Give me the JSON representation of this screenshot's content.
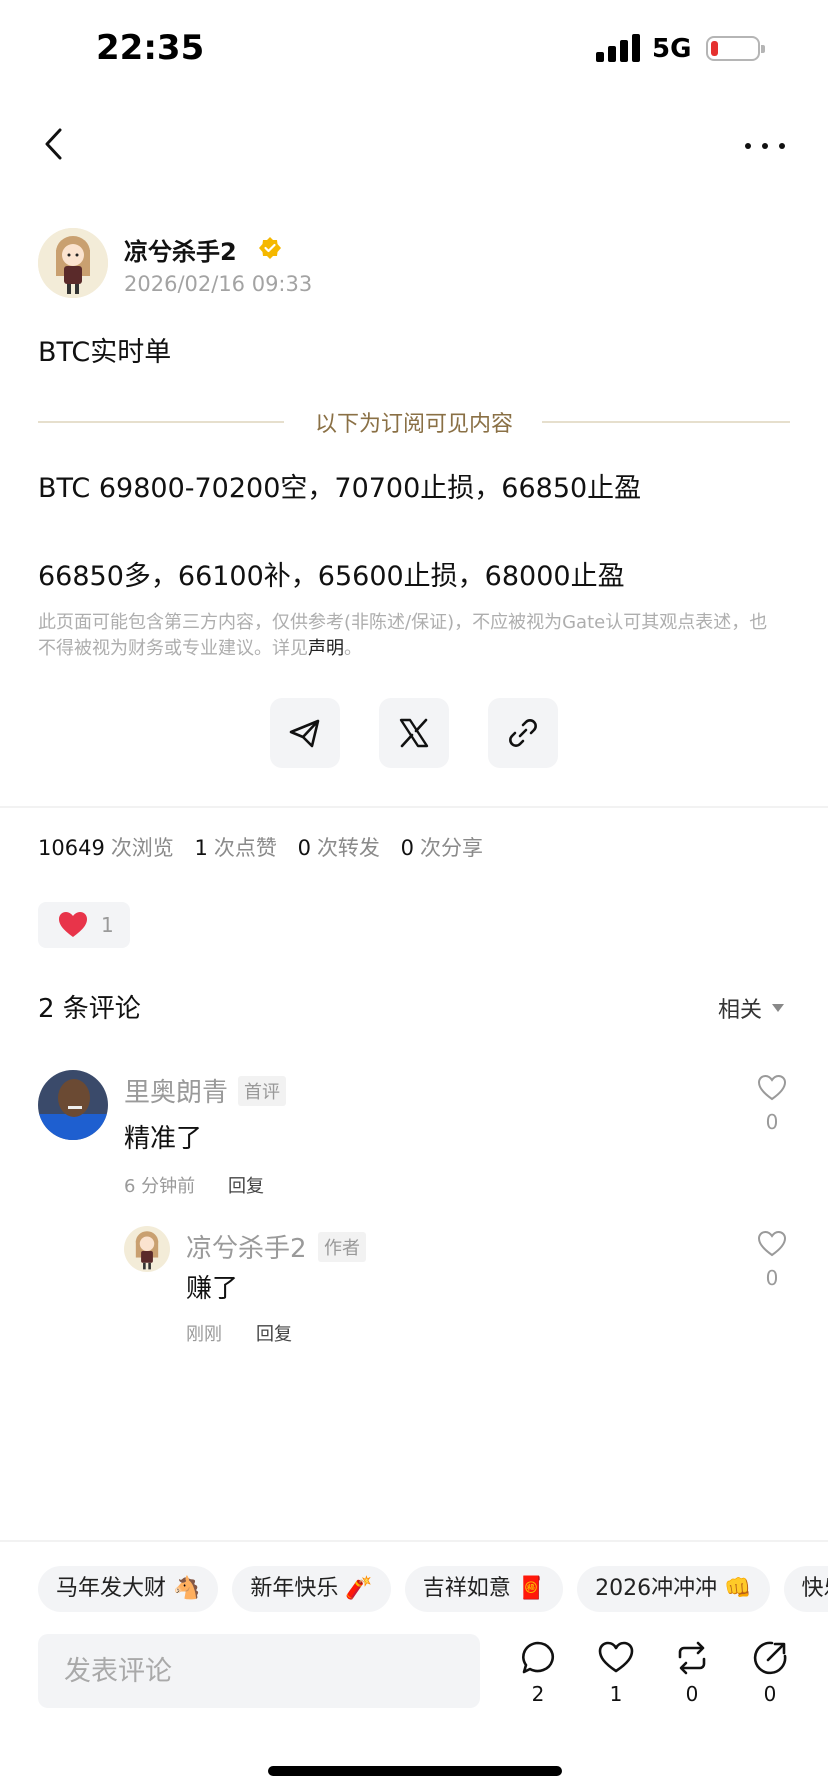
{
  "status_bar": {
    "time": "22:35",
    "network": "5G"
  },
  "post": {
    "author": "凉兮杀手2",
    "timestamp": "2026/02/16 09:33",
    "title": "BTC实时单",
    "divider_label": "以下为订阅可见内容",
    "lines": [
      "BTC 69800-70200空，70700止损，66850止盈",
      "66850多，66100补，65600止损，68000止盈"
    ],
    "disclaimer": "此页面可能包含第三方内容，仅供参考(非陈述/保证)，不应被视为Gate认可其观点表述，也不得被视为财务或专业建议。详见",
    "disclaimer_link": "声明",
    "disclaimer_end": "。"
  },
  "share_buttons": [
    {
      "icon": "telegram-icon"
    },
    {
      "icon": "x-icon"
    },
    {
      "icon": "link-icon"
    }
  ],
  "stats": {
    "views": "10649",
    "views_label": "次浏览",
    "likes": "1",
    "likes_label": "次点赞",
    "reposts": "0",
    "reposts_label": "次转发",
    "shares": "0",
    "shares_label": "次分享"
  },
  "reaction": {
    "icon": "heart-icon",
    "count": "1"
  },
  "comments_header": {
    "title": "2 条评论",
    "sort": "相关"
  },
  "comments": [
    {
      "name": "里奥朗青",
      "tag": "首评",
      "text": "精准了",
      "time": "6 分钟前",
      "reply": "回复",
      "likes": "0"
    },
    {
      "name": "凉兮杀手2",
      "tag": "作者",
      "text": "赚了",
      "time": "刚刚",
      "reply": "回复",
      "likes": "0"
    }
  ],
  "chips": [
    "马年发大财 🐴",
    "新年快乐 🧨",
    "吉祥如意 🧧",
    "2026冲冲冲 👊",
    "快乐"
  ],
  "comment_input": {
    "placeholder": "发表评论"
  },
  "actions": [
    {
      "icon": "comment-icon",
      "count": "2"
    },
    {
      "icon": "heart-icon",
      "count": "1"
    },
    {
      "icon": "repost-icon",
      "count": "0"
    },
    {
      "icon": "share-icon",
      "count": "0"
    }
  ],
  "colors": {
    "accent_gold": "#8a7045",
    "heart_red": "#e8344a",
    "verified_gold": "#f5b800"
  }
}
